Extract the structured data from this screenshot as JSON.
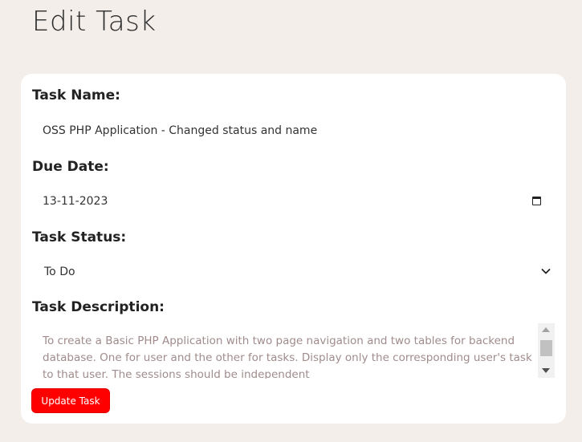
{
  "page": {
    "title": "Edit Task"
  },
  "form": {
    "task_name": {
      "label": "Task Name:",
      "value": "OSS PHP Application - Changed status and name"
    },
    "due_date": {
      "label": "Due Date:",
      "value": "13-11-2023"
    },
    "task_status": {
      "label": "Task Status:",
      "value": "To Do"
    },
    "task_description": {
      "label": "Task Description:",
      "value": "To create a Basic PHP Application with two page navigation and two tables for backend database. One for user and the other for tasks. Display only the corresponding user's task to that user. The sessions should be independent"
    },
    "submit_label": "Update Task"
  },
  "colors": {
    "page_background": "#f3eeea",
    "card_background": "#ffffff",
    "button_background": "#ff0000",
    "description_text": "#a08c8c"
  },
  "icons": {
    "date_picker": "calendar-icon",
    "select": "chevron-down-icon"
  }
}
